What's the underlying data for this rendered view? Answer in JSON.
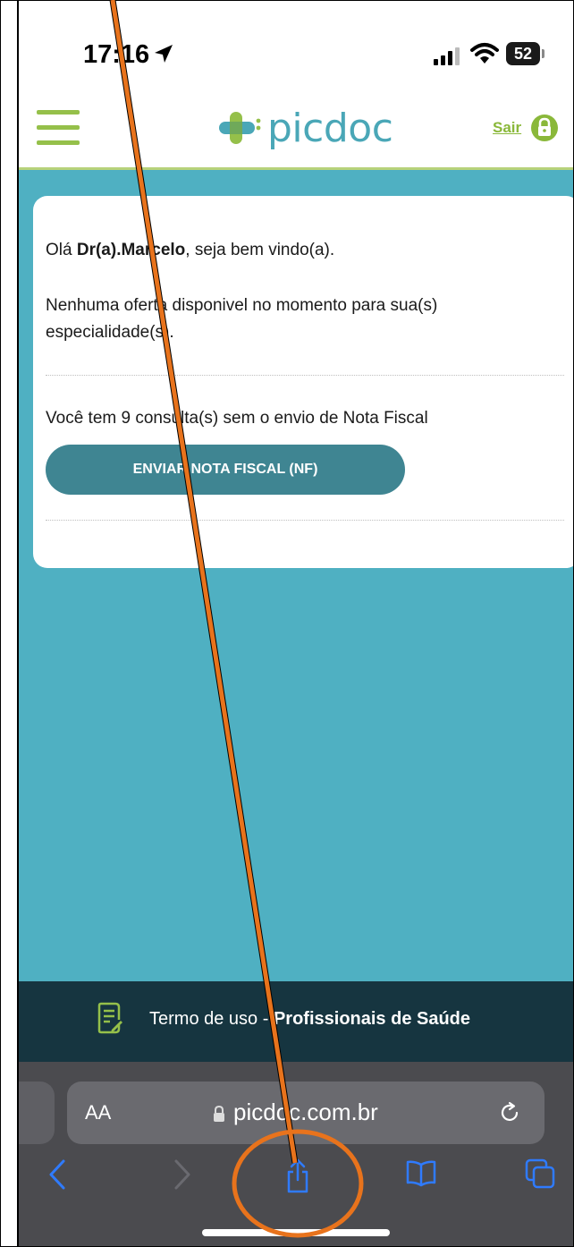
{
  "status_bar": {
    "time": "17:16",
    "battery": "52"
  },
  "header": {
    "logo_text": "picdoc",
    "logout_label": "Sair"
  },
  "card": {
    "greeting_prefix": "Olá ",
    "doctor_name": "Dr(a).Marcelo",
    "greeting_suffix": ", seja bem vindo(a).",
    "no_offers_text": "Nenhuma oferta disponivel no momento para sua(s) especialidade(s).",
    "pending_nf_text": "Você tem 9 consulta(s) sem o envio de Nota Fiscal",
    "send_nf_button": "ENVIAR NOTA FISCAL (NF)"
  },
  "footer": {
    "terms_prefix": "Termo de uso - ",
    "terms_bold": "Profissionais de Saúde"
  },
  "browser": {
    "aa_label": "AA",
    "url": "picdoc.com.br"
  },
  "colors": {
    "teal_bg": "#4fb0c2",
    "brand_green": "#95c04a",
    "annotation_orange": "#e8731c"
  },
  "icons": [
    "location-arrow-icon",
    "signal-icon",
    "wifi-icon",
    "battery-icon",
    "menu-icon",
    "lock-icon",
    "terms-document-icon",
    "reload-icon",
    "back-icon",
    "forward-icon",
    "share-icon",
    "bookmarks-icon",
    "tabs-icon"
  ]
}
